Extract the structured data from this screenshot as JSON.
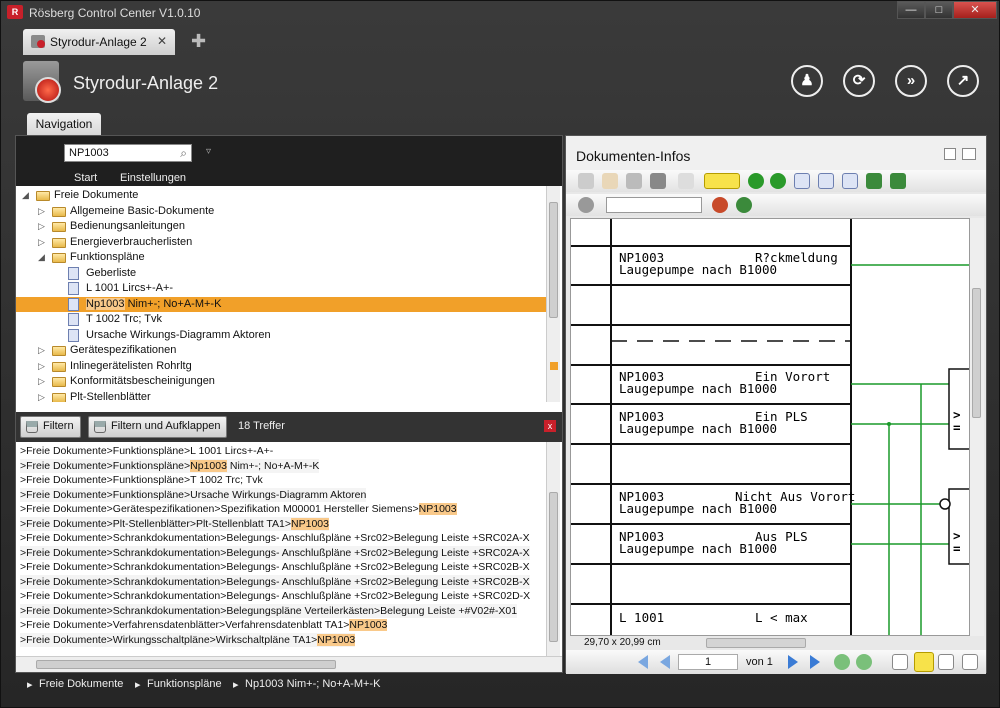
{
  "app": {
    "title": "Rösberg Control Center V1.0.10",
    "logo": "R"
  },
  "window_buttons": {
    "minimize": "—",
    "maximize": "□",
    "close": "✕"
  },
  "tabs": [
    {
      "label": "Styrodur-Anlage 2",
      "close": "✕"
    }
  ],
  "add_tab": "✚",
  "header": {
    "title": "Styrodur-Anlage 2",
    "buttons": [
      {
        "icon": "person-icon",
        "glyph": "♟"
      },
      {
        "icon": "sync-icon",
        "glyph": "⟳"
      },
      {
        "icon": "forward-icon",
        "glyph": "»"
      },
      {
        "icon": "chart-icon",
        "glyph": "↗"
      }
    ]
  },
  "nav_tab": "Navigation",
  "left": {
    "search": "NP1003",
    "search_glyph": "⌕",
    "dropdown": "▿",
    "toolbar": [
      "Start",
      "Einstellungen"
    ]
  },
  "tree": [
    {
      "level": 0,
      "exp": "◢",
      "type": "folder",
      "label": "Freie Dokumente"
    },
    {
      "level": 1,
      "exp": "▷",
      "type": "folder",
      "label": "Allgemeine Basic-Dokumente"
    },
    {
      "level": 1,
      "exp": "▷",
      "type": "folder",
      "label": "Bedienungsanleitungen"
    },
    {
      "level": 1,
      "exp": "▷",
      "type": "folder",
      "label": "Energieverbraucherlisten"
    },
    {
      "level": 1,
      "exp": "◢",
      "type": "folder",
      "label": "Funktionspläne"
    },
    {
      "level": 2,
      "exp": "",
      "type": "doc",
      "label": "Geberliste"
    },
    {
      "level": 2,
      "exp": "",
      "type": "doc",
      "label": "L 1001 Lircs+-A+-"
    },
    {
      "level": 2,
      "exp": "",
      "type": "doc",
      "label": "Np1003",
      "rest": " Nim+-; No+A-M+-K",
      "selected": true
    },
    {
      "level": 2,
      "exp": "",
      "type": "doc",
      "label": "T 1002 Trc; Tvk"
    },
    {
      "level": 2,
      "exp": "",
      "type": "doc",
      "label": "Ursache Wirkungs-Diagramm Aktoren"
    },
    {
      "level": 1,
      "exp": "▷",
      "type": "folder",
      "label": "Gerätespezifikationen"
    },
    {
      "level": 1,
      "exp": "▷",
      "type": "folder",
      "label": "Inlinegerätelisten Rohrltg"
    },
    {
      "level": 1,
      "exp": "▷",
      "type": "folder",
      "label": "Konformitätsbescheinigungen"
    },
    {
      "level": 1,
      "exp": "▷",
      "type": "folder",
      "label": "Plt-Stellenblätter"
    }
  ],
  "filter": {
    "btn1": "Filtern",
    "btn2": "Filtern und Aufklappen",
    "count": "18 Treffer",
    "close": "x"
  },
  "results": [
    {
      "pre": ">Freie Dokumente>Funktionspläne>L 1001 Lircs+-A+-",
      "hit": "",
      "post": ""
    },
    {
      "pre": ">Freie Dokumente>Funktionspläne>",
      "hit": "Np1003",
      "post": " Nim+-; No+A-M+-K"
    },
    {
      "pre": ">Freie Dokumente>Funktionspläne>T 1002 Trc; Tvk",
      "hit": "",
      "post": ""
    },
    {
      "pre": ">Freie Dokumente>Funktionspläne>Ursache Wirkungs-Diagramm Aktoren",
      "hit": "",
      "post": ""
    },
    {
      "pre": ">Freie Dokumente>Gerätespezifikationen>Spezifikation M00001 Hersteller  Siemens>",
      "hit": "NP1003",
      "post": ""
    },
    {
      "pre": ">Freie Dokumente>Plt-Stellenblätter>Plt-Stellenblatt TA1>",
      "hit": "NP1003",
      "post": ""
    },
    {
      "pre": ">Freie Dokumente>Schrankdokumentation>Belegungs- Anschlußpläne +Src02>Belegung Leiste +SRC02A-X",
      "hit": "",
      "post": ""
    },
    {
      "pre": ">Freie Dokumente>Schrankdokumentation>Belegungs- Anschlußpläne +Src02>Belegung Leiste +SRC02A-X",
      "hit": "",
      "post": ""
    },
    {
      "pre": ">Freie Dokumente>Schrankdokumentation>Belegungs- Anschlußpläne +Src02>Belegung Leiste +SRC02B-X",
      "hit": "",
      "post": ""
    },
    {
      "pre": ">Freie Dokumente>Schrankdokumentation>Belegungs- Anschlußpläne +Src02>Belegung Leiste +SRC02B-X",
      "hit": "",
      "post": ""
    },
    {
      "pre": ">Freie Dokumente>Schrankdokumentation>Belegungs- Anschlußpläne +Src02>Belegung Leiste +SRC02D-X",
      "hit": "",
      "post": ""
    },
    {
      "pre": ">Freie Dokumente>Schrankdokumentation>Belegungspläne Verteilerkästen>Belegung Leiste +#V02#-X01",
      "hit": "",
      "post": ""
    },
    {
      "pre": ">Freie Dokumente>Verfahrensdatenblätter>Verfahrensdatenblatt TA1>",
      "hit": "NP1003",
      "post": ""
    },
    {
      "pre": ">Freie Dokumente>Wirkungsschaltpläne>Wirkschaltpläne TA1>",
      "hit": "NP1003",
      "post": ""
    }
  ],
  "right": {
    "title": "Dokumenten-Infos",
    "status_dim": "29,70 x 20,99 cm",
    "page": "1",
    "von": "von 1"
  },
  "drawing": [
    {
      "a": "NP1003",
      "b": "R?ckmeldung",
      "c": "Laugepumpe  nach  B1000"
    },
    {
      "a": "NP1003",
      "b": "Ein  Vorort",
      "c": "Laugepumpe  nach  B1000"
    },
    {
      "a": "NP1003",
      "b": "Ein  PLS",
      "c": "Laugepumpe  nach  B1000"
    },
    {
      "a": "NP1003",
      "b": "Nicht  Aus  Vorort",
      "c": "Laugepumpe  nach  B1000"
    },
    {
      "a": "NP1003",
      "b": "Aus  PLS",
      "c": "Laugepumpe  nach  B1000"
    },
    {
      "a": "L  1001",
      "b": "L  <  max",
      "c": ""
    }
  ],
  "breadcrumb": [
    "Freie Dokumente",
    "Funktionspläne",
    "Np1003 Nim+-; No+A-M+-K"
  ],
  "colors": {
    "selection": "#f1a029",
    "highlight": "#f9c98a",
    "accent_red": "#c8202a",
    "wire_green": "#1a9a2a"
  }
}
